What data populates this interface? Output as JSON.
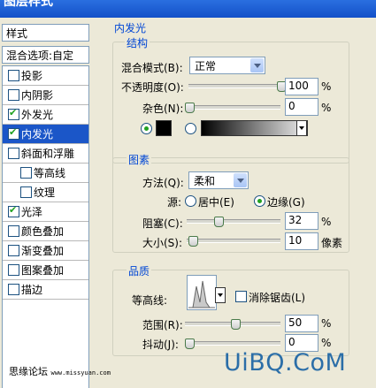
{
  "window": {
    "title": "图层样式"
  },
  "left_panel": {
    "styles_label": "样式",
    "blending_label": "混合选项:自定",
    "items": [
      {
        "label": "投影",
        "checked": false,
        "selected": false
      },
      {
        "label": "内阴影",
        "checked": false,
        "selected": false
      },
      {
        "label": "外发光",
        "checked": true,
        "selected": false
      },
      {
        "label": "内发光",
        "checked": true,
        "selected": true
      },
      {
        "label": "斜面和浮雕",
        "checked": false,
        "selected": false
      },
      {
        "label": "等高线",
        "checked": false,
        "selected": false
      },
      {
        "label": "纹理",
        "checked": false,
        "selected": false
      },
      {
        "label": "光泽",
        "checked": true,
        "selected": false
      },
      {
        "label": "颜色叠加",
        "checked": false,
        "selected": false
      },
      {
        "label": "渐变叠加",
        "checked": false,
        "selected": false
      },
      {
        "label": "图案叠加",
        "checked": false,
        "selected": false
      },
      {
        "label": "描边",
        "checked": false,
        "selected": false
      }
    ]
  },
  "footer": {
    "text": "思缘论坛",
    "url": "www.missyuan.com"
  },
  "watermark": "UiBQ.CoM",
  "panel": {
    "title": "内发光",
    "structure": {
      "title": "结构",
      "blend_mode_label": "混合模式(B):",
      "blend_mode_value": "正常",
      "opacity_label": "不透明度(O):",
      "opacity_value": "100",
      "opacity_level": 1.0,
      "noise_label": "杂色(N):",
      "noise_value": "0",
      "noise_level": 0.0,
      "percent": "%",
      "solid_color": "#000000"
    },
    "elements": {
      "title": "图素",
      "technique_label": "方法(Q):",
      "technique_value": "柔和",
      "source_label": "源:",
      "source_center": "居中(E)",
      "source_edge": "边缘(G)",
      "choke_label": "阻塞(C):",
      "choke_value": "32",
      "choke_level": 0.32,
      "size_label": "大小(S):",
      "size_value": "10",
      "size_level": 0.04,
      "size_unit": "像素",
      "percent": "%"
    },
    "quality": {
      "title": "品质",
      "contour_label": "等高线:",
      "anti_alias_label": "消除锯齿(L)",
      "range_label": "范围(R):",
      "range_value": "50",
      "range_level": 0.5,
      "jitter_label": "抖动(J):",
      "jitter_value": "0",
      "jitter_level": 0.0,
      "percent": "%"
    }
  }
}
